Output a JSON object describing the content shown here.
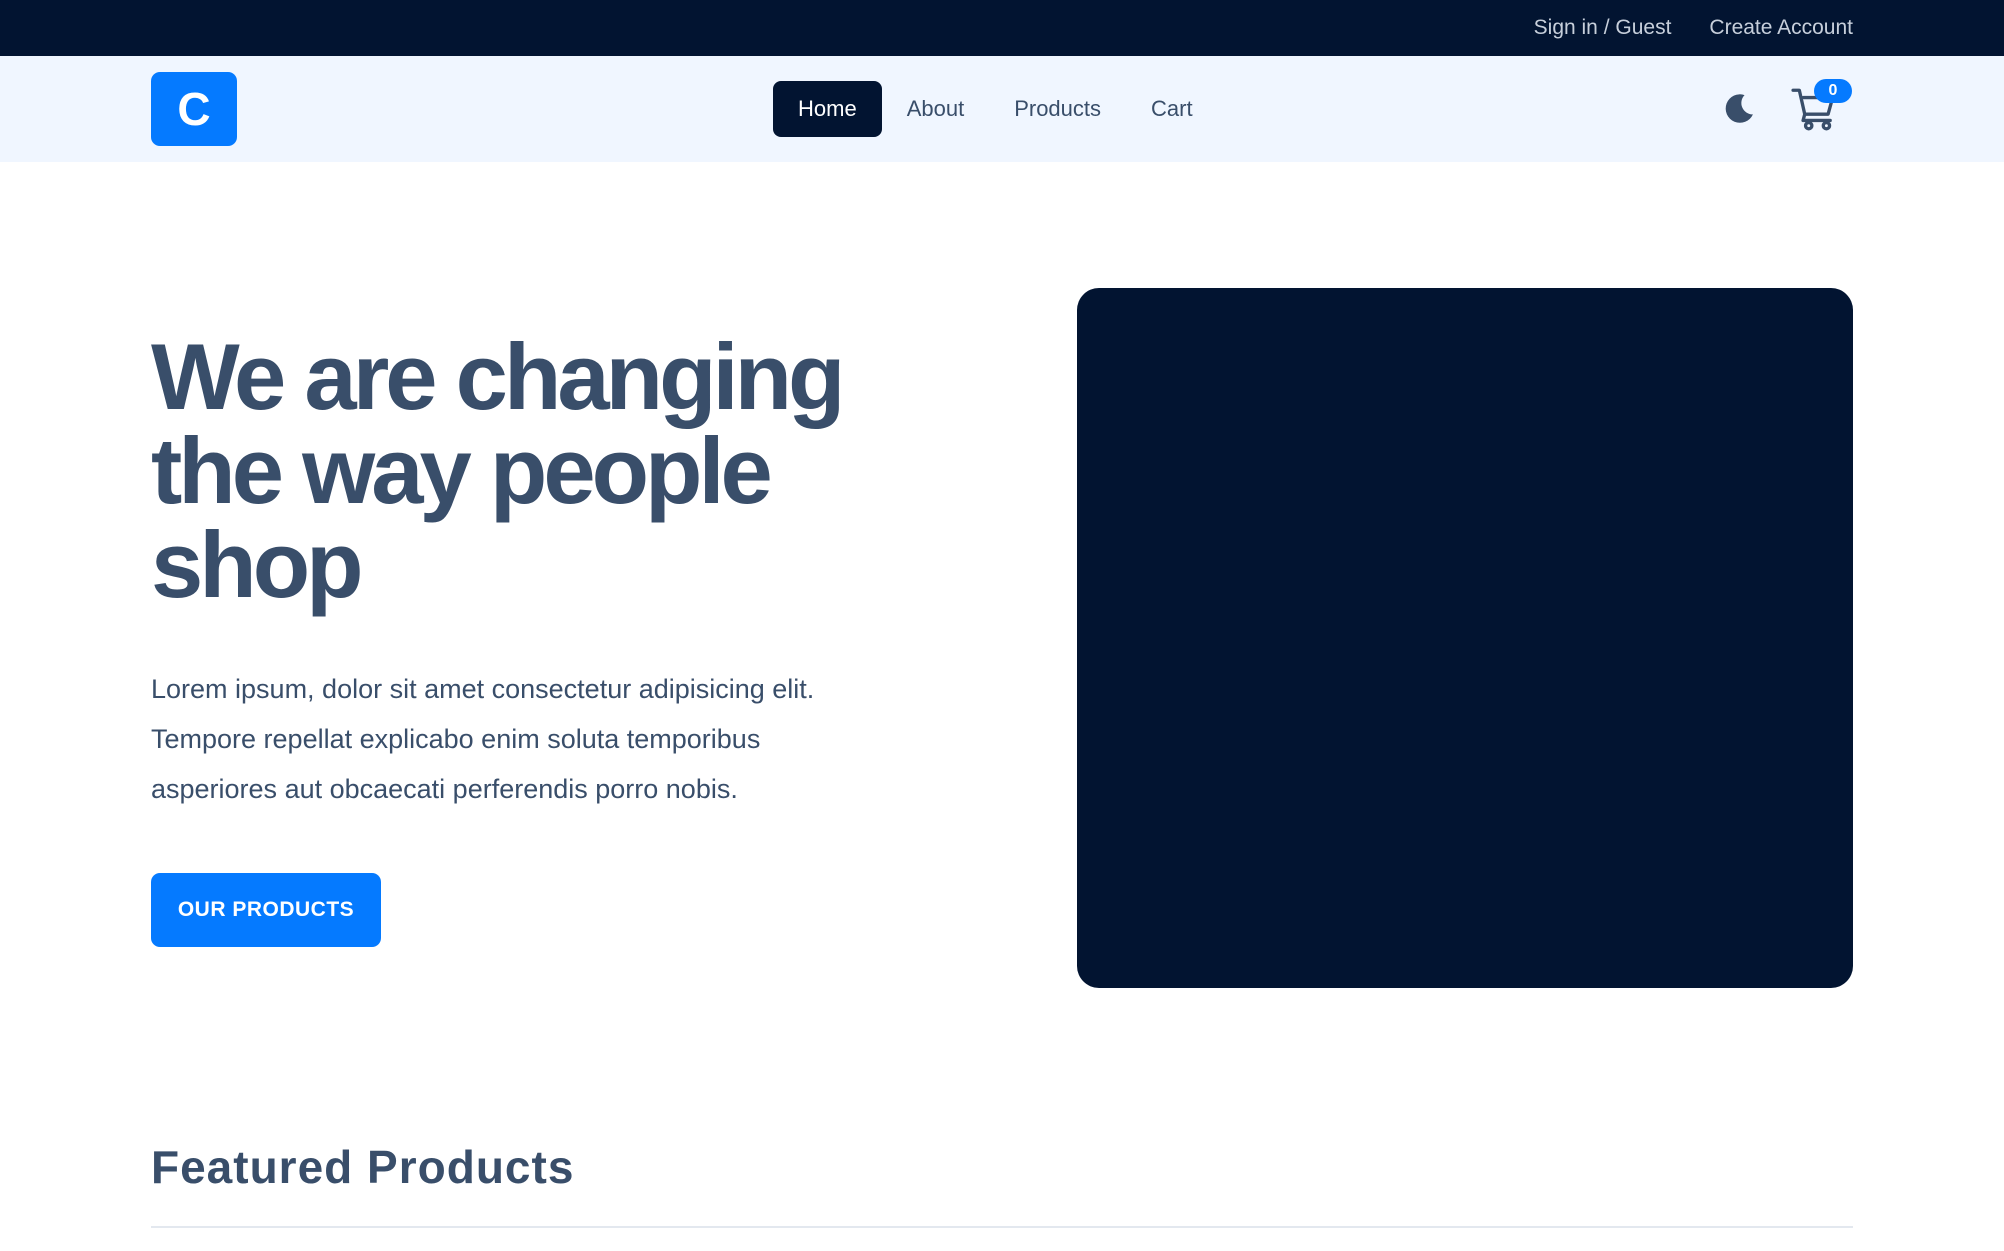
{
  "topbar": {
    "sign_in_label": "Sign in / Guest",
    "create_account_label": "Create Account"
  },
  "navbar": {
    "logo_letter": "C",
    "links": [
      {
        "label": "Home",
        "active": true
      },
      {
        "label": "About",
        "active": false
      },
      {
        "label": "Products",
        "active": false
      },
      {
        "label": "Cart",
        "active": false
      }
    ],
    "theme_icon": "moon-icon",
    "cart_icon": "cart-icon",
    "cart_count": "0"
  },
  "hero": {
    "title": "We are changing the way people shop",
    "description": "Lorem ipsum, dolor sit amet consectetur adipisicing elit. Tempore repellat explicabo enim soluta temporibus asperiores aut obcaecati perferendis porro nobis.",
    "cta_label": "OUR PRODUCTS"
  },
  "featured": {
    "title": "Featured Products"
  },
  "colors": {
    "primary": "#057aff",
    "dark": "#021431",
    "text": "#394e6a",
    "navbar_bg": "#f0f6ff"
  }
}
